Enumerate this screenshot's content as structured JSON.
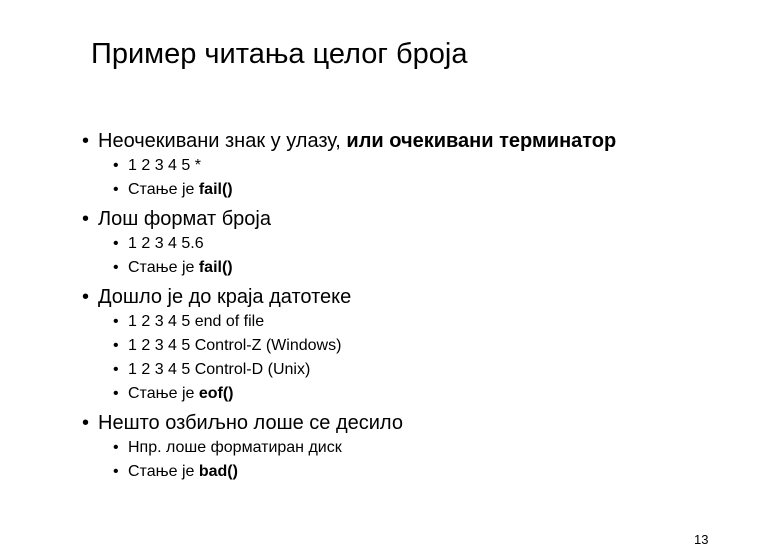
{
  "slide": {
    "title": "Пример читања целог броја",
    "page_number": "13",
    "bullets": [
      {
        "text": "Неочекивани знак у улазу, ",
        "bold": "или очекивани терминатор",
        "sub": [
          {
            "text": "1 2 3 4 5 *",
            "bold": ""
          },
          {
            "text": "Стање је ",
            "bold": "fail()"
          }
        ]
      },
      {
        "text": "Лош формат броја",
        "bold": "",
        "sub": [
          {
            "text": "1 2 3 4 5.6",
            "bold": ""
          },
          {
            "text": "Стање је ",
            "bold": "fail()"
          }
        ]
      },
      {
        "text": "Дошло је до краја датотеке",
        "bold": "",
        "sub": [
          {
            "text": "1 2 3 4 5 end of file",
            "bold": ""
          },
          {
            "text": "1 2 3 4 5 Control-Z (Windows)",
            "bold": ""
          },
          {
            "text": "1 2 3 4 5 Control-D (Unix)",
            "bold": ""
          },
          {
            "text": "Стање је ",
            "bold": "eof()"
          }
        ]
      },
      {
        "text": "Нешто озбиљно лоше се десило",
        "bold": "",
        "sub": [
          {
            "text": "Нпр. лоше форматиран диск",
            "bold": ""
          },
          {
            "text": "Стање је ",
            "bold": "bad()"
          }
        ]
      }
    ]
  }
}
